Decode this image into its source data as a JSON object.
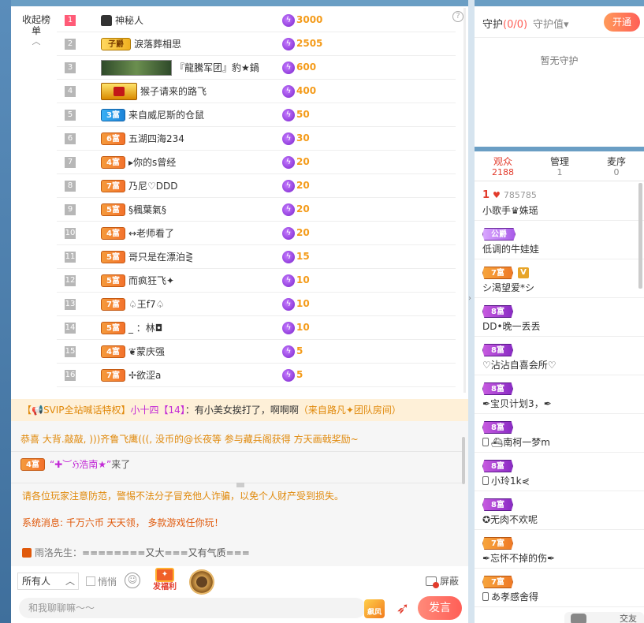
{
  "rank": {
    "collapse_label": "收起榜单",
    "rows": [
      {
        "num": "1",
        "badge": "",
        "badge_type": "mystery",
        "name": "神秘人",
        "score": "3000"
      },
      {
        "num": "2",
        "badge": "子爵",
        "badge_type": "gold",
        "name": "淚落葬相思",
        "score": "2505"
      },
      {
        "num": "3",
        "badge": "",
        "badge_type": "image",
        "name": "『龍騰军团』豹★鍋",
        "score": "600"
      },
      {
        "num": "4",
        "badge": "",
        "badge_type": "crown",
        "name": "猴子请来的路飞",
        "score": "400"
      },
      {
        "num": "5",
        "badge": "3富",
        "badge_type": "blue",
        "name": "来自威尼斯的仓鼠",
        "score": "50"
      },
      {
        "num": "6",
        "badge": "6富",
        "badge_type": "orange",
        "name": "五湖四海234",
        "score": "30"
      },
      {
        "num": "7",
        "badge": "4富",
        "badge_type": "orange",
        "name": "▸你的s曾经",
        "score": "20"
      },
      {
        "num": "8",
        "badge": "7富",
        "badge_type": "orange",
        "name": "乃尼♡DDD",
        "score": "20"
      },
      {
        "num": "9",
        "badge": "5富",
        "badge_type": "orange",
        "name": "§楓葉氣§",
        "score": "20"
      },
      {
        "num": "10",
        "badge": "4富",
        "badge_type": "orange",
        "name": "↔老师看了",
        "score": "20"
      },
      {
        "num": "11",
        "badge": "5富",
        "badge_type": "orange",
        "name": "哥只是在漂泊⋛",
        "score": "15"
      },
      {
        "num": "12",
        "badge": "5富",
        "badge_type": "orange",
        "name": "而疯狂飞✦",
        "score": "10"
      },
      {
        "num": "13",
        "badge": "7富",
        "badge_type": "orange",
        "name": "♤王f7♤",
        "score": "10"
      },
      {
        "num": "14",
        "badge": "5富",
        "badge_type": "orange",
        "name": "_ ：林◘",
        "score": "10"
      },
      {
        "num": "15",
        "badge": "4富",
        "badge_type": "orange",
        "name": "❦蒙庆强",
        "score": "5"
      },
      {
        "num": "16",
        "badge": "7富",
        "badge_type": "orange",
        "name": "✢欲涩a",
        "score": "5"
      }
    ]
  },
  "notice": {
    "prefix": "【📢SVIP全站喊话特权】",
    "user": "小十四【14】",
    "message": "：有小美女挨打了，啊啊啊",
    "source": "（来自路凡✦团队房间）"
  },
  "chat": {
    "line1": "恭喜 大背.敲敲, )))齐鲁飞鹰(((, 没币的@长夜等 参与藏兵阁获得 方天画戟奖励~",
    "line2_badge": "4富",
    "line2_name": "“✚︶ℌ浩南★”",
    "line2_text": "来了",
    "line3": "请各位玩家注意防范，警惕不法分子冒充他人诈骗，以免个人财产受到损失。",
    "line4": "系统消息: 千万六币 天天领， 多款游戏任你玩！",
    "line5_name": "雨洛先生：",
    "line5_text": "========又大===又有气质==="
  },
  "toolbar": {
    "target": "所有人",
    "quiet_label": "悄悄",
    "welfare_label": "发福利",
    "shield_label": "屏蔽"
  },
  "input": {
    "placeholder": "和我聊聊嘛～～",
    "send_label": "发言",
    "feng_label": "飙风"
  },
  "guard": {
    "title": "守护",
    "count": "(0/0)",
    "value_label": "守护值▾",
    "open_label": "开通",
    "empty": "暂无守护"
  },
  "audience": {
    "tabs": [
      {
        "label": "观众",
        "count": "2188"
      },
      {
        "label": "管理",
        "count": "1"
      },
      {
        "label": "麦序",
        "count": "0"
      }
    ],
    "users": [
      {
        "top_rank": "1",
        "top_id": "785785",
        "badge": "",
        "badge_type": "",
        "name": "小歌手♛姝瑶"
      },
      {
        "top_rank": "",
        "top_id": "",
        "badge": "公爵",
        "badge_type": "gold",
        "name": "低调的牛娃娃"
      },
      {
        "top_rank": "",
        "top_id": "",
        "badge": "7富",
        "badge_type": "orange",
        "vip": "V",
        "name": "シ渴望爱*シ"
      },
      {
        "top_rank": "",
        "top_id": "",
        "badge": "8富",
        "badge_type": "purple",
        "name": "DD•晚一丢丢"
      },
      {
        "top_rank": "",
        "top_id": "",
        "badge": "8富",
        "badge_type": "purple",
        "name": "♡沾沾自喜会所♡"
      },
      {
        "top_rank": "",
        "top_id": "",
        "badge": "8富",
        "badge_type": "purple",
        "name": "✒宝贝计划3，✒"
      },
      {
        "top_rank": "",
        "top_id": "",
        "badge": "8富",
        "badge_type": "purple",
        "phone": true,
        "name": "⛴南柯一梦m"
      },
      {
        "top_rank": "",
        "top_id": "",
        "badge": "8富",
        "badge_type": "purple",
        "phone": true,
        "name": "小玲1k⋞"
      },
      {
        "top_rank": "",
        "top_id": "",
        "badge": "8富",
        "badge_type": "purple",
        "name": "✪无肉不欢呢"
      },
      {
        "top_rank": "",
        "top_id": "",
        "badge": "7富",
        "badge_type": "orange",
        "name": "✒忘怀不掉的伤✒"
      },
      {
        "top_rank": "",
        "top_id": "",
        "badge": "7富",
        "badge_type": "orange",
        "phone": true,
        "name": "あ孝感舍得"
      }
    ]
  },
  "float_chat": {
    "label": "交友"
  },
  "colors": {
    "accent": "#ff5f57",
    "gift": "#9b3fe0",
    "score": "#f49b1a",
    "notice_bg": "#fef0d8"
  }
}
